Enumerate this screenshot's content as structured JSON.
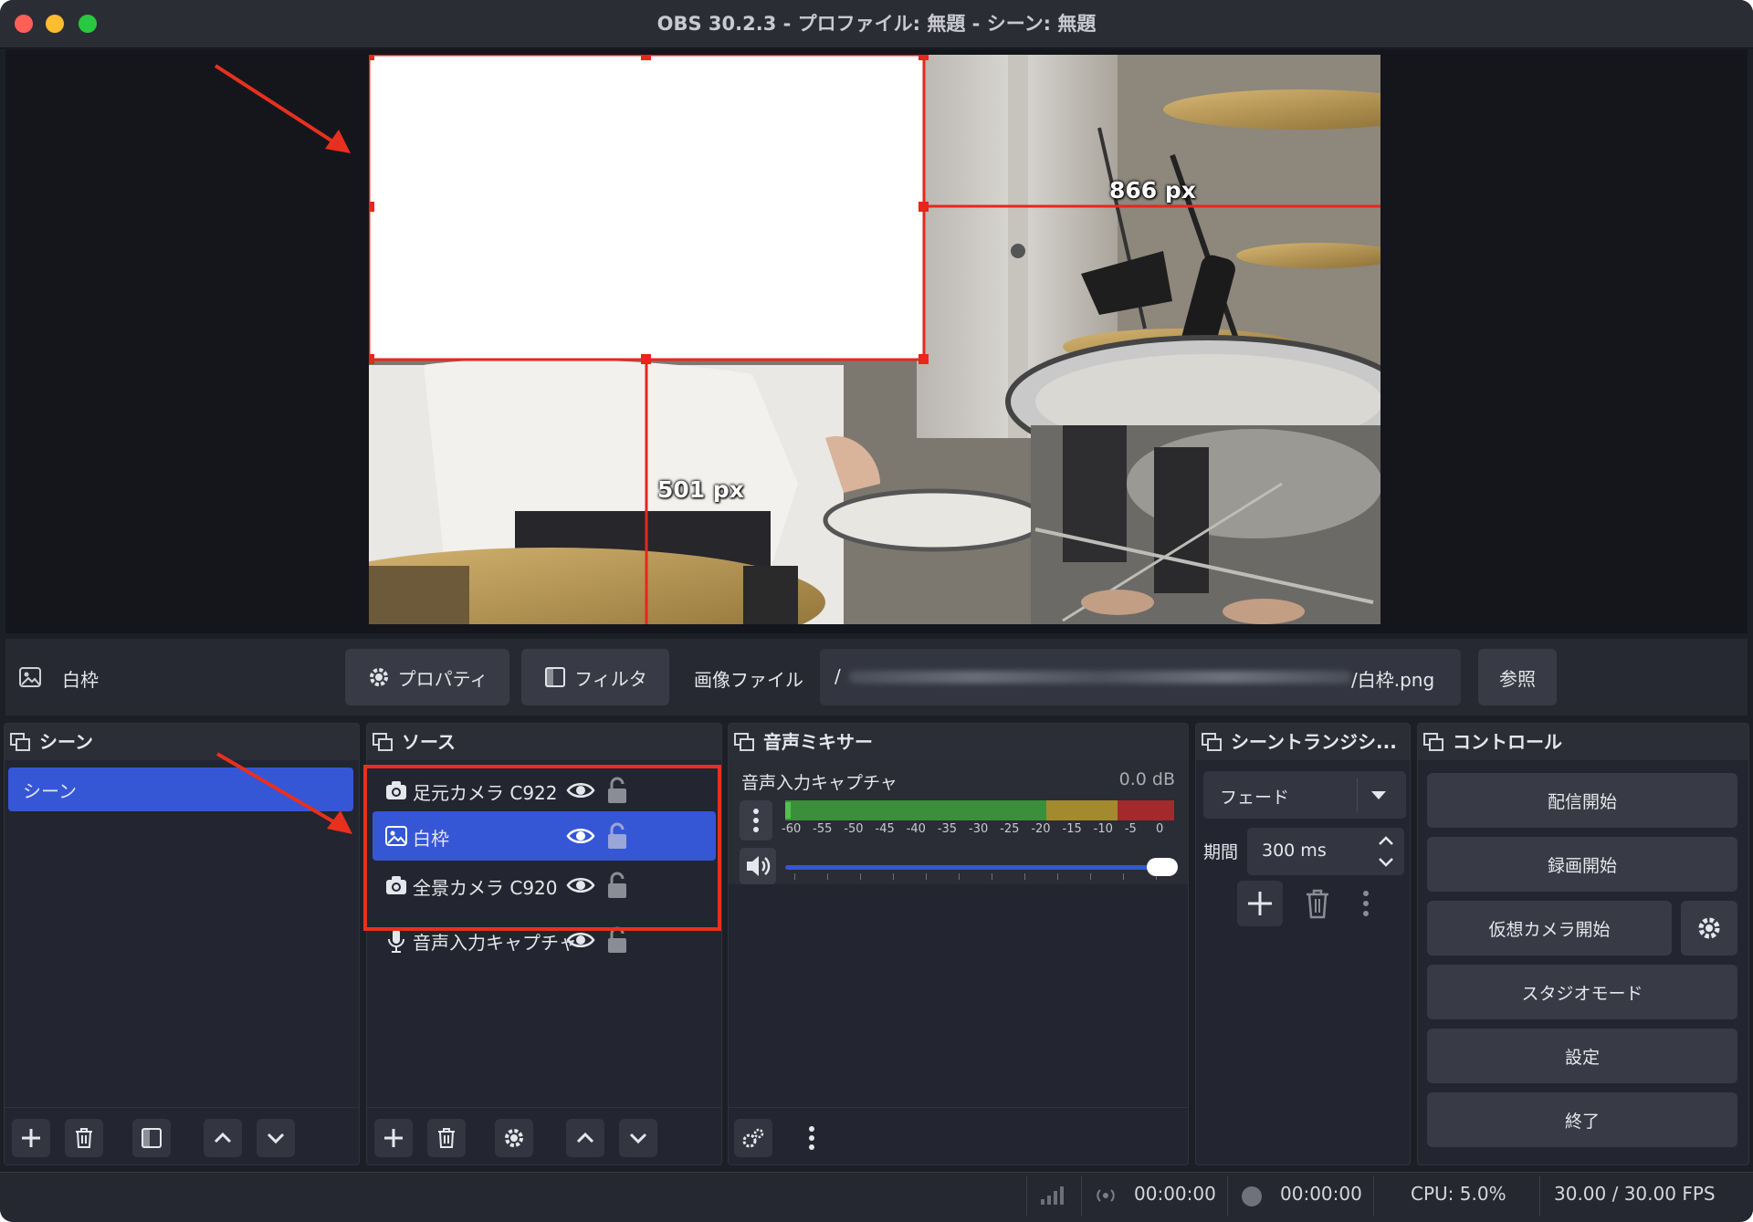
{
  "window": {
    "title": "OBS 30.2.3 - プロファイル: 無題 - シーン: 無題",
    "colors": {
      "close": "#fe5f57",
      "minimize": "#febc2e",
      "zoom": "#28c840",
      "accent": "#3557d6",
      "annotation": "#e8301e"
    }
  },
  "preview": {
    "width_label": "866 px",
    "height_label": "501 px"
  },
  "source_toolbar": {
    "selected_source": "白枠",
    "properties_label": "プロパティ",
    "filters_label": "フィルタ",
    "image_file_label": "画像ファイル",
    "path_prefix": "/",
    "path_suffix": "/白枠.png",
    "browse_label": "参照"
  },
  "scenes": {
    "title": "シーン",
    "items": [
      {
        "label": "シーン",
        "selected": true
      }
    ]
  },
  "sources": {
    "title": "ソース",
    "items": [
      {
        "label": "足元カメラ C922",
        "icon": "camera-icon",
        "selected": false
      },
      {
        "label": "白枠",
        "icon": "image-icon",
        "selected": true
      },
      {
        "label": "全景カメラ C920",
        "icon": "camera-icon",
        "selected": false
      },
      {
        "label": "音声入力キャプチャ",
        "icon": "microphone-icon",
        "selected": false
      }
    ]
  },
  "mixer": {
    "title": "音声ミキサー",
    "channel_name": "音声入力キャプチャ",
    "level": "0.0 dB",
    "scale": [
      "-60",
      "-55",
      "-50",
      "-45",
      "-40",
      "-35",
      "-30",
      "-25",
      "-20",
      "-15",
      "-10",
      "-5",
      "0"
    ],
    "volume_fraction": 1.0
  },
  "transitions": {
    "title": "シーントランジシ...",
    "selected": "フェード",
    "duration_label": "期間",
    "duration_value": "300 ms"
  },
  "controls": {
    "title": "コントロール",
    "start_streaming": "配信開始",
    "start_recording": "録画開始",
    "start_virtual_camera": "仮想カメラ開始",
    "studio_mode": "スタジオモード",
    "settings": "設定",
    "exit": "終了"
  },
  "status_bar": {
    "stream_time": "00:00:00",
    "record_time": "00:00:00",
    "cpu": "CPU: 5.0%",
    "fps": "30.00 / 30.00 FPS"
  }
}
